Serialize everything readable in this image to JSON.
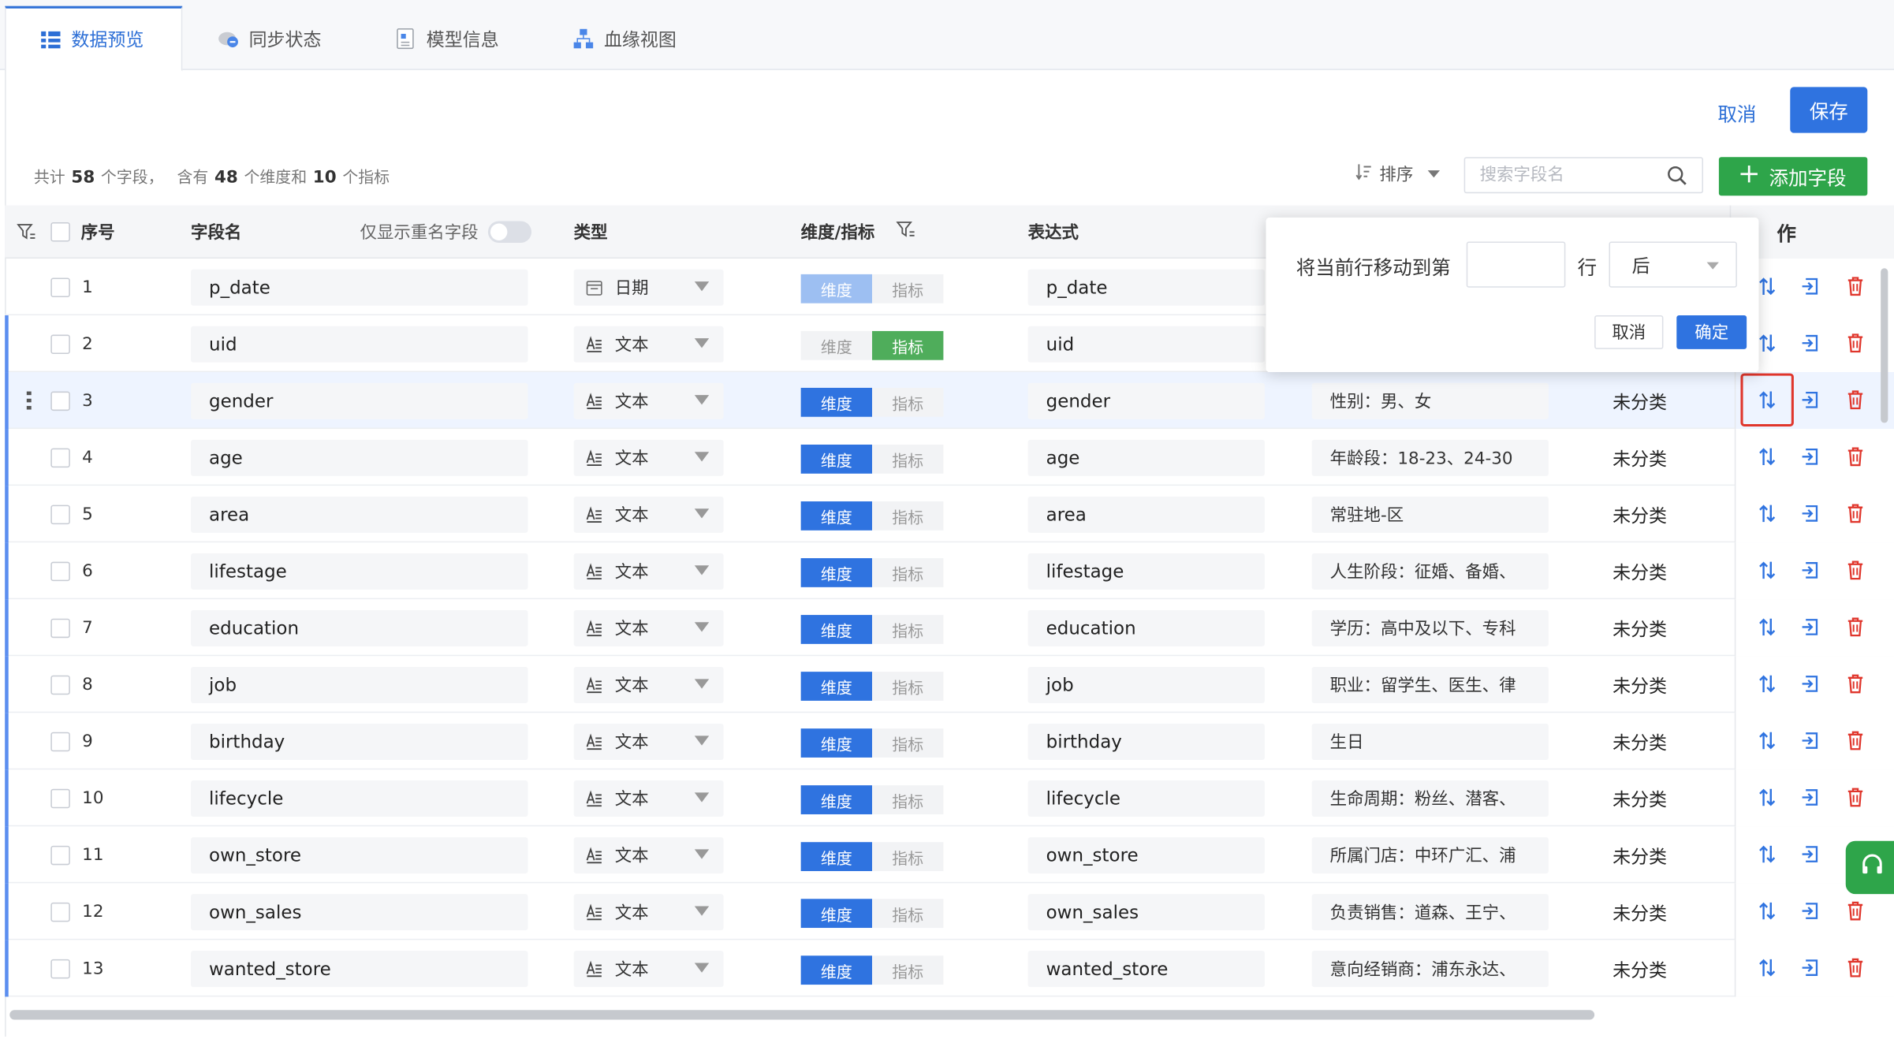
{
  "tabs": [
    {
      "label": "数据预览",
      "icon": "grid-icon",
      "active": true
    },
    {
      "label": "同步状态",
      "icon": "cloud-sync-icon",
      "active": false
    },
    {
      "label": "模型信息",
      "icon": "document-icon",
      "active": false
    },
    {
      "label": "血缘视图",
      "icon": "lineage-icon",
      "active": false
    }
  ],
  "header_actions": {
    "cancel": "取消",
    "save": "保存"
  },
  "summary": {
    "prefix": "共计",
    "total": "58",
    "fields_text": "个字段，",
    "contains": "含有",
    "dims": "48",
    "dims_text": "个维度和",
    "metrics": "10",
    "metrics_text": "个指标"
  },
  "toolbar": {
    "sort_label": "排序",
    "search_placeholder": "搜索字段名",
    "add_field": "添加字段"
  },
  "columns": {
    "seq": "序号",
    "field_name": "字段名",
    "dup_only": "仅显示重名字段",
    "type": "类型",
    "dim_metric": "维度/指标",
    "expression": "表达式",
    "ops": "作"
  },
  "dm_labels": {
    "dim": "维度",
    "metric": "指标"
  },
  "rows": [
    {
      "seq": "1",
      "name": "p_date",
      "type": "日期",
      "type_icon": "calendar-icon",
      "mode": "dim-disabled",
      "expr": "p_date",
      "desc": "",
      "cat": ""
    },
    {
      "seq": "2",
      "name": "uid",
      "type": "文本",
      "type_icon": "text-icon",
      "mode": "metric",
      "expr": "uid",
      "desc": "",
      "cat": ""
    },
    {
      "seq": "3",
      "name": "gender",
      "type": "文本",
      "type_icon": "text-icon",
      "mode": "dim",
      "expr": "gender",
      "desc": "性别：男、女",
      "cat": "未分类"
    },
    {
      "seq": "4",
      "name": "age",
      "type": "文本",
      "type_icon": "text-icon",
      "mode": "dim",
      "expr": "age",
      "desc": "年龄段：18-23、24-30",
      "cat": "未分类"
    },
    {
      "seq": "5",
      "name": "area",
      "type": "文本",
      "type_icon": "text-icon",
      "mode": "dim",
      "expr": "area",
      "desc": "常驻地-区",
      "cat": "未分类"
    },
    {
      "seq": "6",
      "name": "lifestage",
      "type": "文本",
      "type_icon": "text-icon",
      "mode": "dim",
      "expr": "lifestage",
      "desc": "人生阶段：征婚、备婚、",
      "cat": "未分类"
    },
    {
      "seq": "7",
      "name": "education",
      "type": "文本",
      "type_icon": "text-icon",
      "mode": "dim",
      "expr": "education",
      "desc": "学历：高中及以下、专科",
      "cat": "未分类"
    },
    {
      "seq": "8",
      "name": "job",
      "type": "文本",
      "type_icon": "text-icon",
      "mode": "dim",
      "expr": "job",
      "desc": "职业：留学生、医生、律",
      "cat": "未分类"
    },
    {
      "seq": "9",
      "name": "birthday",
      "type": "文本",
      "type_icon": "text-icon",
      "mode": "dim",
      "expr": "birthday",
      "desc": "生日",
      "cat": "未分类"
    },
    {
      "seq": "10",
      "name": "lifecycle",
      "type": "文本",
      "type_icon": "text-icon",
      "mode": "dim",
      "expr": "lifecycle",
      "desc": "生命周期：粉丝、潜客、",
      "cat": "未分类"
    },
    {
      "seq": "11",
      "name": "own_store",
      "type": "文本",
      "type_icon": "text-icon",
      "mode": "dim",
      "expr": "own_store",
      "desc": "所属门店：中环广汇、浦",
      "cat": "未分类"
    },
    {
      "seq": "12",
      "name": "own_sales",
      "type": "文本",
      "type_icon": "text-icon",
      "mode": "dim",
      "expr": "own_sales",
      "desc": "负责销售：道森、王宁、",
      "cat": "未分类"
    },
    {
      "seq": "13",
      "name": "wanted_store",
      "type": "文本",
      "type_icon": "text-icon",
      "mode": "dim",
      "expr": "wanted_store",
      "desc": "意向经销商：浦东永达、",
      "cat": "未分类"
    }
  ],
  "popover": {
    "label": "将当前行移动到第",
    "row_label": "行",
    "position_value": "后",
    "cancel": "取消",
    "confirm": "确定"
  },
  "colors": {
    "primary": "#2f73e0",
    "green": "#2ea54a",
    "danger": "#e0362c"
  }
}
